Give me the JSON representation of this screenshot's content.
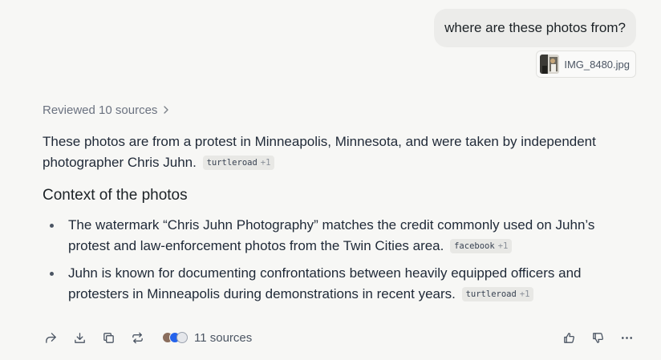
{
  "user_message": {
    "text": "where are these photos from?"
  },
  "attachment": {
    "filename": "IMG_8480.jpg",
    "icon": "image-thumbnail"
  },
  "reviewed": {
    "label": "Reviewed 10 sources",
    "icon": "chevron-right-icon"
  },
  "answer": {
    "text": "These photos are from a protest in Minneapolis, Minnesota, and were taken by independent photographer Chris Juhn.",
    "citation": {
      "source": "turtleroad",
      "more": "+1"
    }
  },
  "section": {
    "heading": "Context of the photos"
  },
  "bullets": [
    {
      "text": "The watermark “Chris Juhn Photography” matches the credit commonly used on Juhn’s protest and law-enforcement photos from the Twin Cities area.",
      "citation": {
        "source": "facebook",
        "more": "+1"
      }
    },
    {
      "text": "Juhn is known for documenting confrontations between heavily equipped officers and protesters in Minneapolis during demonstrations in recent years.",
      "citation": {
        "source": "turtleroad",
        "more": "+1"
      }
    }
  ],
  "toolbar": {
    "actions": [
      "share-icon",
      "download-icon",
      "copy-icon",
      "rewrite-icon"
    ],
    "sources_label": "11 sources",
    "favicon_colors": [
      "#8a6d5c",
      "#2563eb",
      "#6b7280"
    ],
    "feedback": [
      "thumbs-up-icon",
      "thumbs-down-icon",
      "more-icon"
    ]
  }
}
